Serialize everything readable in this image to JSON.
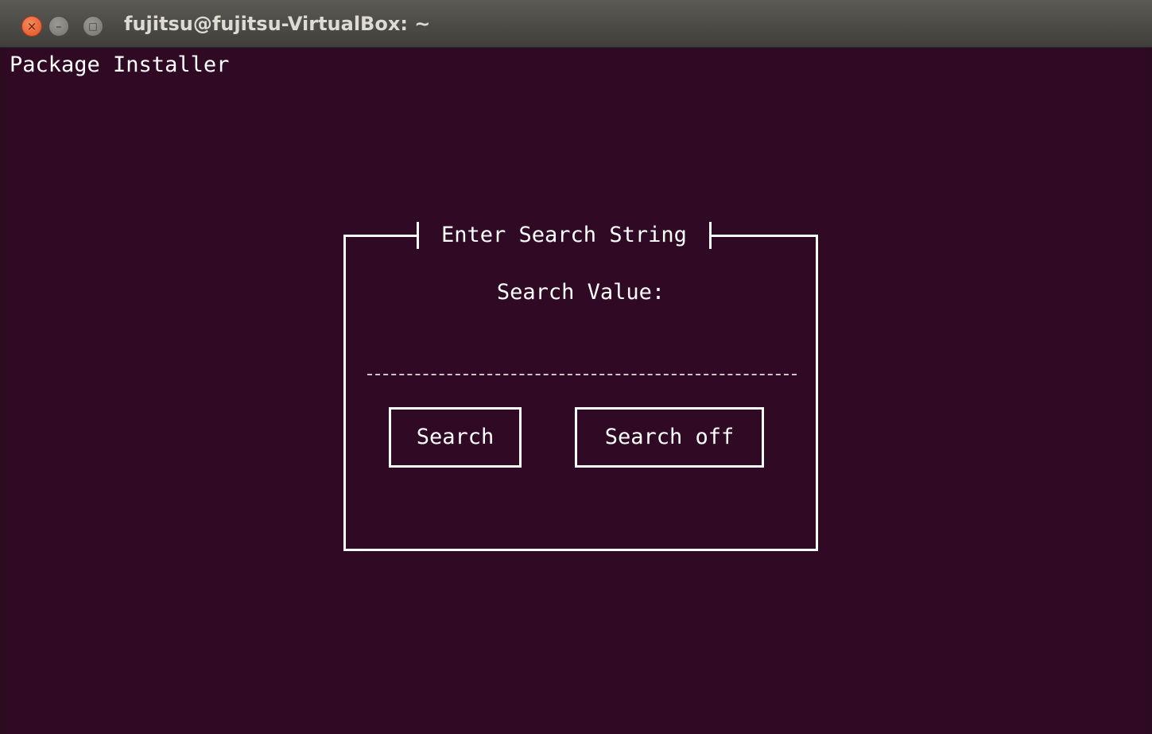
{
  "window": {
    "title": "fujitsu@fujitsu-VirtualBox: ~",
    "close_glyph": "×",
    "minimize_glyph": "–",
    "maximize_glyph": "□"
  },
  "app": {
    "title": "Package Installer"
  },
  "dialog": {
    "title": "Enter Search String",
    "label": "Search Value:",
    "search_value": "",
    "search_button": "Search",
    "search_off_button": "Search off"
  },
  "colors": {
    "terminal_bg": "#300a24",
    "titlebar": "#4c4b47",
    "close_button": "#e9592a",
    "text": "#ffffff"
  }
}
